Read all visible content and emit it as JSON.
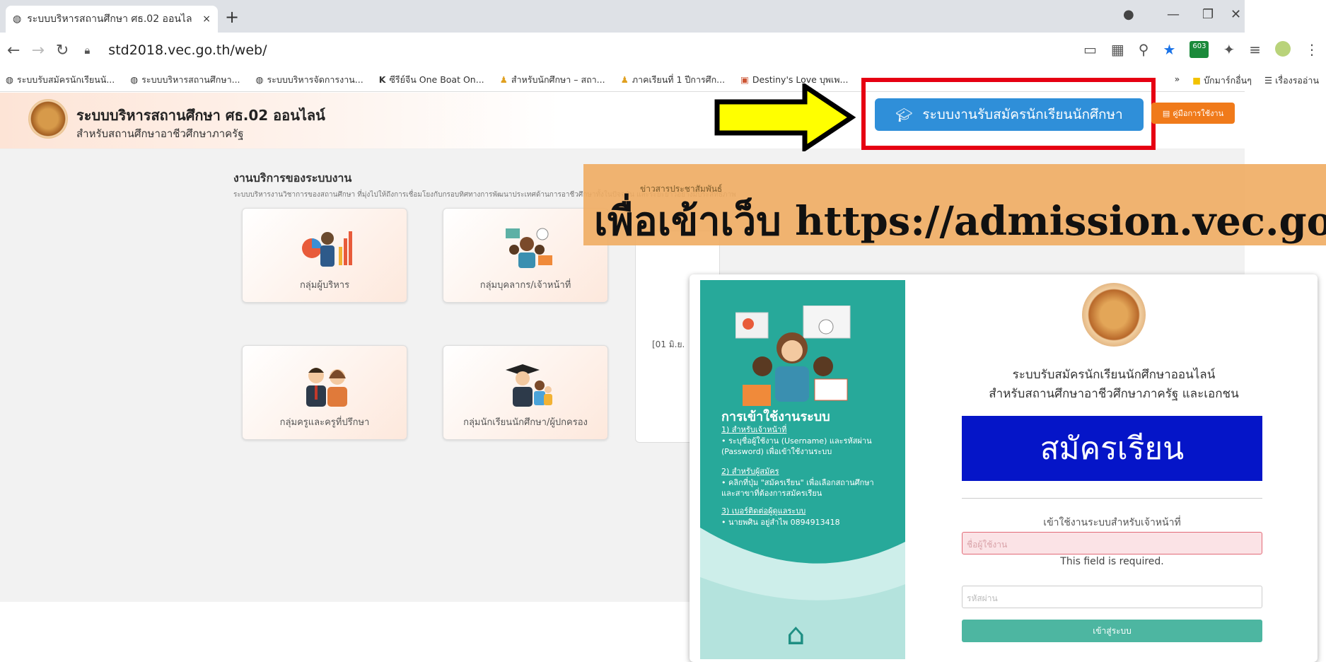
{
  "browser": {
    "tab_title": "ระบบบริหารสถานศึกษา ศธ.02 ออนไล",
    "tab_close": "×",
    "new_tab": "+",
    "url": "std2018.vec.go.th/web/",
    "bookmarks": [
      "ระบบรับสมัครนักเรียนนั...",
      "ระบบบริหารสถานศึกษา...",
      "ระบบบริหารจัดการงาน...",
      "ซีรีย์จีน One Boat On...",
      "สำหรับนักศึกษา – สถา...",
      "ภาคเรียนที่ 1 ปีการศึก...",
      "Destiny's Love บุพเพ..."
    ],
    "bookmarks_more": "»",
    "bookmark_folder": "บ๊กมาร์กอื่นๆ",
    "reading_list": "เรื่องรออ่าน",
    "badge": "603"
  },
  "site": {
    "title": "ระบบบริหารสถานศึกษา ศธ.02 ออนไลน์",
    "subtitle": "สำหรับสถานศึกษาอาชีวศึกษาภาครัฐ",
    "register_button": "ระบบงานรับสมัครนักเรียนนักศึกษา",
    "manual_button": "คู่มือการใช้งาน"
  },
  "services": {
    "heading": "งานบริการของระบบงาน",
    "description": "ระบบบริหารงานวิชาการของสถานศึกษา ที่มุ่งไปให้ถึงการเชื่อมโยงกับกรอบทิศทางการพัฒนาประเทศด้านการอาชีวศึกษาทั้งในปัจจุบัน และระยะยาวอย่างมีประสิทธิภาพ",
    "cards": [
      {
        "label": "กลุ่มผู้บริหาร"
      },
      {
        "label": "กลุ่มบุคลากร/เจ้าหน้าที่"
      },
      {
        "label": "กลุ่มครูและครูที่ปรึกษา"
      },
      {
        "label": "กลุ่มนักเรียนนักศึกษา/ผู้ปกครอง"
      }
    ],
    "news_heading": "ข่าวสารประชาสัมพันธ์",
    "news_date": "[01 มิ.ย."
  },
  "banner": {
    "text": "เพื่อเข้าเว็บ https://admission.vec.go"
  },
  "login": {
    "panel_heading": "การเข้าใช้งานระบบ",
    "staff_title": "1) สำหรับเจ้าหน้าที่",
    "staff_text": "• ระบุชื่อผู้ใช้งาน (Username) และรหัสผ่าน (Password) เพื่อเข้าใช้งานระบบ",
    "applicant_title": "2) สำหรับผู้สมัคร",
    "applicant_text": "• คลิกที่ปุ่ม \"สมัครเรียน\" เพื่อเลือกสถานศึกษา และสาขาที่ต้องการสมัครเรียน",
    "contact_title": "3) เบอร์ติดต่อผู้ดูแลระบบ",
    "contact_text": "• นายพศิน อยู่สำไพ 0894913418",
    "system_line1": "ระบบรับสมัครนักเรียนนักศึกษาออนไลน์",
    "system_line2": "สำหรับสถานศึกษาอาชีวศึกษาภาครัฐ และเอกชน",
    "apply_button": "สมัครเรียน",
    "staff_login_label": "เข้าใช้งานระบบสำหรับเจ้าหน้าที่",
    "username_placeholder": "ชื่อผู้ใช้งาน",
    "required_msg": "This field is required.",
    "password_placeholder": "รหัสผ่าน",
    "login_button": "เข้าสู่ระบบ"
  },
  "colors": {
    "highlight_border": "#e60012",
    "arrow_fill": "#ffff00",
    "register_blue": "#2f8fd9",
    "apply_blue": "#0515c8",
    "teal": "#27a99a",
    "banner": "#f0ac62"
  }
}
